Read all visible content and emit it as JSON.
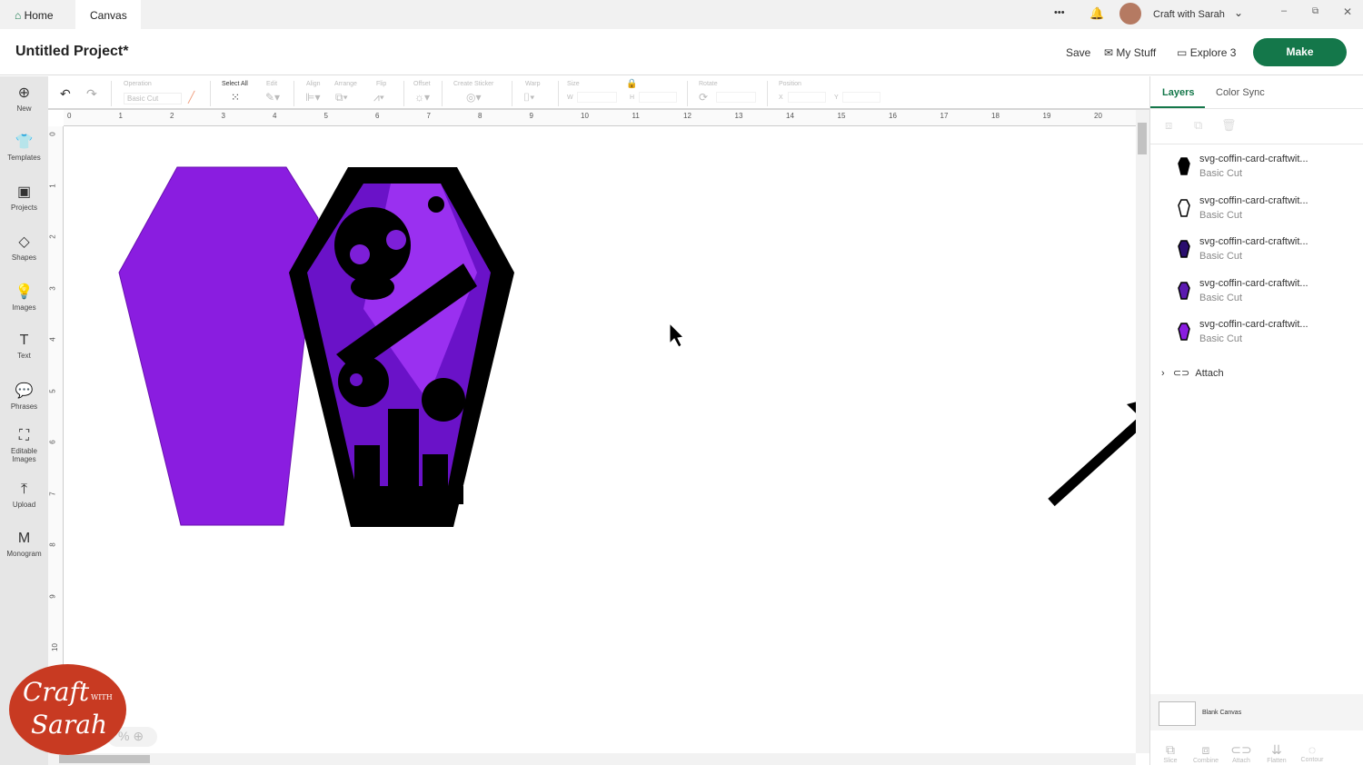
{
  "tabs": {
    "home": "Home",
    "canvas": "Canvas"
  },
  "topbar": {
    "more": "•••",
    "user": "Craft with Sarah"
  },
  "header": {
    "title": "Untitled Project*",
    "save": "Save",
    "my_stuff": "My Stuff",
    "machine": "Explore 3",
    "make": "Make"
  },
  "sidebar": [
    {
      "icon": "⊕",
      "label": "New"
    },
    {
      "icon": "👕",
      "label": "Templates"
    },
    {
      "icon": "▣",
      "label": "Projects"
    },
    {
      "icon": "◇",
      "label": "Shapes"
    },
    {
      "icon": "💡",
      "label": "Images"
    },
    {
      "icon": "T",
      "label": "Text"
    },
    {
      "icon": "💬",
      "label": "Phrases"
    },
    {
      "icon": "⛶",
      "label": "Editable Images"
    },
    {
      "icon": "⤒",
      "label": "Upload"
    },
    {
      "icon": "M",
      "label": "Monogram"
    }
  ],
  "toolbar": {
    "operation": "Operation",
    "operation_value": "Basic Cut",
    "select_all": "Select All",
    "edit": "Edit",
    "align": "Align",
    "arrange": "Arrange",
    "flip": "Flip",
    "offset": "Offset",
    "create_sticker": "Create Sticker",
    "warp": "Warp",
    "size": "Size",
    "w": "W",
    "h": "H",
    "rotate": "Rotate",
    "position": "Position",
    "x": "X",
    "y": "Y"
  },
  "ruler_top": [
    "0",
    "1",
    "2",
    "3",
    "4",
    "5",
    "6",
    "7",
    "8",
    "9",
    "10",
    "11",
    "12",
    "13",
    "14",
    "15",
    "16",
    "17",
    "18",
    "19",
    "20"
  ],
  "ruler_left": [
    "0",
    "1",
    "2",
    "3",
    "4",
    "5",
    "6",
    "7",
    "8",
    "9",
    "10"
  ],
  "colors": {
    "purple": "#8a1de0",
    "dark": "#000000",
    "accent": "#14774a"
  },
  "panel": {
    "tabs": [
      "Layers",
      "Color Sync"
    ],
    "layers": [
      {
        "name": "svg-coffin-card-craftwit...",
        "op": "Basic Cut",
        "color": "#000000"
      },
      {
        "name": "svg-coffin-card-craftwit...",
        "op": "Basic Cut",
        "color": "#ffffff"
      },
      {
        "name": "svg-coffin-card-craftwit...",
        "op": "Basic Cut",
        "color": "#2a0e6e"
      },
      {
        "name": "svg-coffin-card-craftwit...",
        "op": "Basic Cut",
        "color": "#5b1ab0"
      },
      {
        "name": "svg-coffin-card-craftwit...",
        "op": "Basic Cut",
        "color": "#8a1de0"
      }
    ],
    "group": "Attach",
    "blank_canvas": "Blank Canvas",
    "bottom_tools": [
      "Slice",
      "Combine",
      "Attach",
      "Flatten",
      "Contour"
    ]
  },
  "zoom": "%",
  "logo": {
    "line1": "Craft",
    "with": "WITH",
    "line2": "Sarah"
  }
}
